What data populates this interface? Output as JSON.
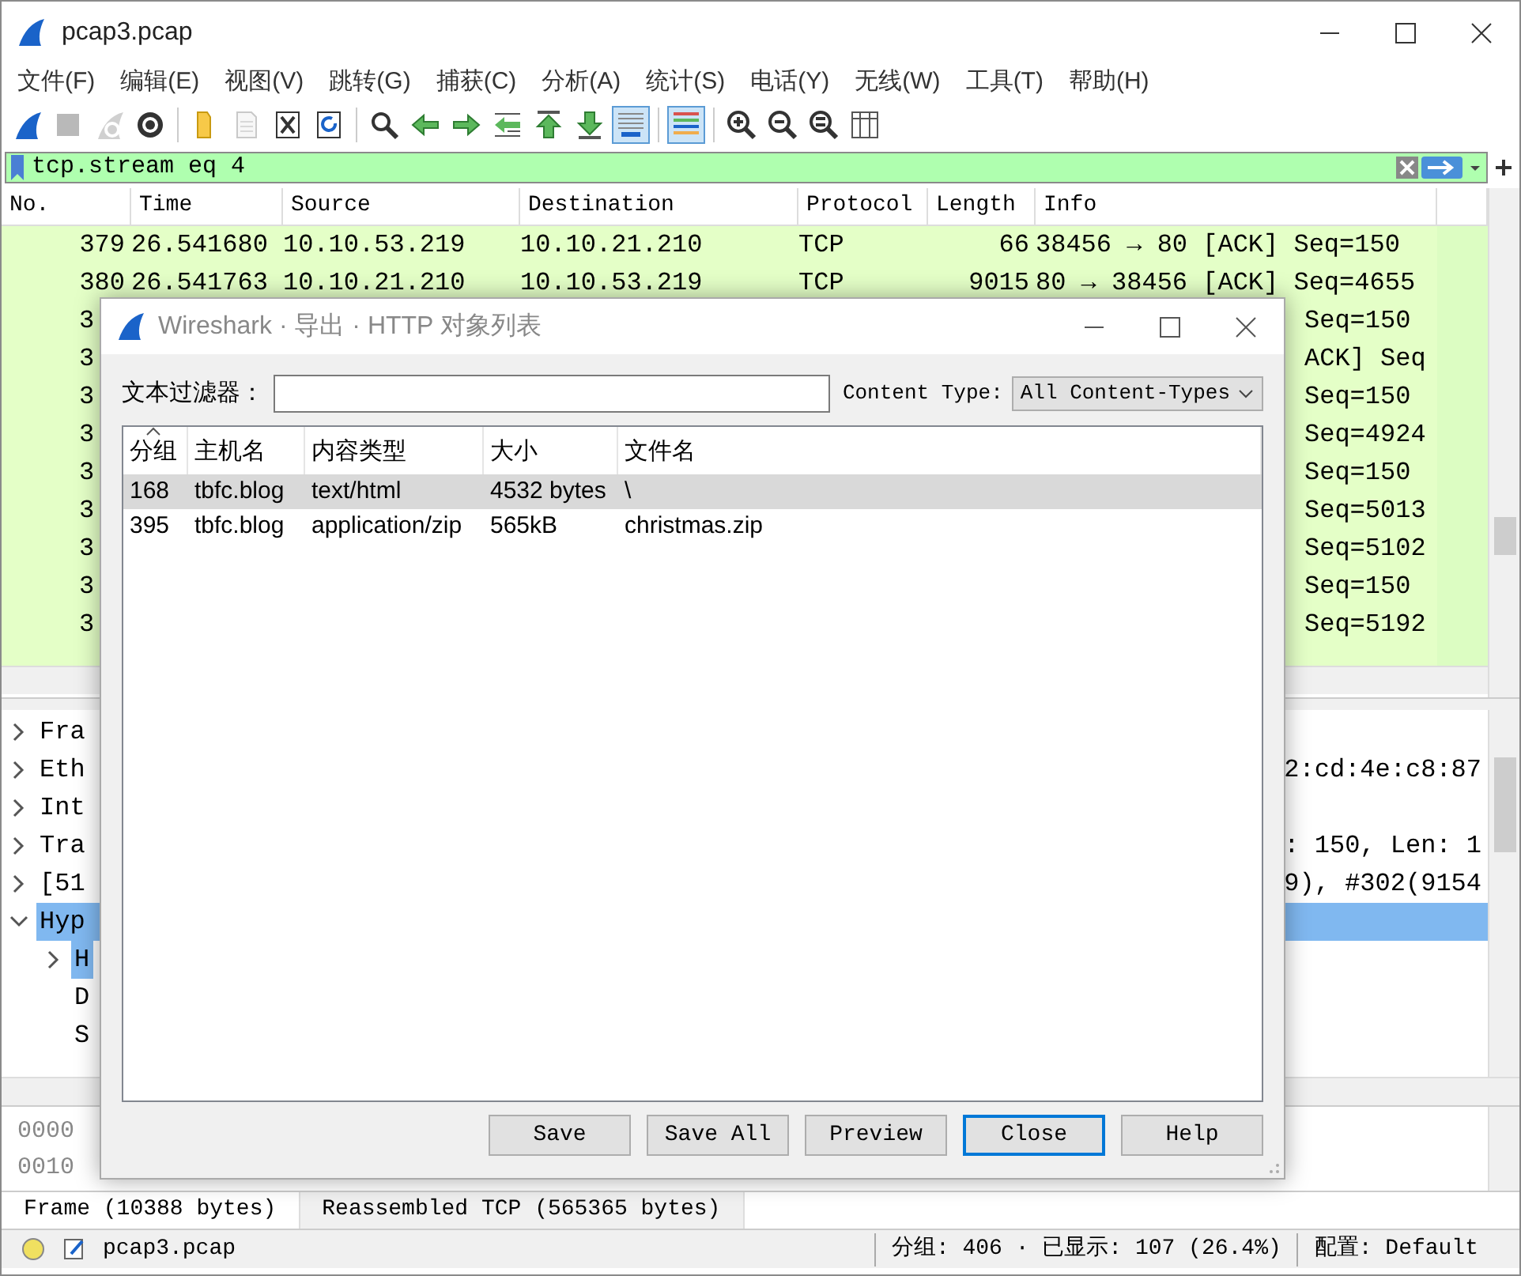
{
  "window": {
    "title": "pcap3.pcap"
  },
  "menu": [
    "文件(F)",
    "编辑(E)",
    "视图(V)",
    "跳转(G)",
    "捕获(C)",
    "分析(A)",
    "统计(S)",
    "电话(Y)",
    "无线(W)",
    "工具(T)",
    "帮助(H)"
  ],
  "toolbar": [
    [
      {
        "kind": "shark",
        "disabled": false,
        "pressed": false
      },
      {
        "kind": "stop",
        "disabled": true,
        "pressed": false
      },
      {
        "kind": "restart",
        "disabled": true,
        "pressed": false
      },
      {
        "kind": "options",
        "disabled": false,
        "pressed": false
      }
    ],
    [
      {
        "kind": "open",
        "disabled": false,
        "pressed": false
      },
      {
        "kind": "file",
        "disabled": true,
        "pressed": false
      },
      {
        "kind": "close",
        "disabled": false,
        "pressed": false
      },
      {
        "kind": "reload",
        "disabled": false,
        "pressed": false
      }
    ],
    [
      {
        "kind": "find",
        "disabled": false,
        "pressed": false
      },
      {
        "kind": "back",
        "disabled": false,
        "pressed": false
      },
      {
        "kind": "forward",
        "disabled": false,
        "pressed": false
      },
      {
        "kind": "goto",
        "disabled": false,
        "pressed": false
      },
      {
        "kind": "first",
        "disabled": false,
        "pressed": false
      },
      {
        "kind": "last",
        "disabled": false,
        "pressed": false
      },
      {
        "kind": "autoscroll",
        "disabled": false,
        "pressed": true
      }
    ],
    [
      {
        "kind": "colorize",
        "disabled": false,
        "pressed": true
      }
    ],
    [
      {
        "kind": "zoom_in",
        "disabled": false,
        "pressed": false
      },
      {
        "kind": "zoom_out",
        "disabled": false,
        "pressed": false
      },
      {
        "kind": "zoom_reset",
        "disabled": false,
        "pressed": false
      },
      {
        "kind": "resize",
        "disabled": false,
        "pressed": false
      }
    ]
  ],
  "display_filter": {
    "value": "tcp.stream eq 4"
  },
  "packet_list": {
    "columns": [
      "No.",
      "Time",
      "Source",
      "Destination",
      "Protocol",
      "Length",
      "Info"
    ],
    "rows": [
      {
        "kind": "full",
        "no": "379",
        "time": "26.541680",
        "source": "10.10.53.219",
        "destination": "10.10.21.210",
        "protocol": "TCP",
        "length": "66",
        "info": "38456 → 80 [ACK] Seq=150"
      },
      {
        "kind": "full",
        "no": "380",
        "time": "26.541763",
        "source": "10.10.21.210",
        "destination": "10.10.53.219",
        "protocol": "TCP",
        "length": "9015",
        "info": "80 → 38456 [ACK] Seq=4655"
      },
      {
        "kind": "partial",
        "no": "3",
        "info": "Seq=150"
      },
      {
        "kind": "partial",
        "no": "3",
        "info": "ACK] Seq"
      },
      {
        "kind": "partial",
        "no": "3",
        "info": "Seq=150"
      },
      {
        "kind": "partial",
        "no": "3",
        "info": "Seq=4924"
      },
      {
        "kind": "partial",
        "no": "3",
        "info": "Seq=150"
      },
      {
        "kind": "partial",
        "no": "3",
        "info": "Seq=5013"
      },
      {
        "kind": "partial",
        "no": "3",
        "info": "Seq=5102"
      },
      {
        "kind": "partial",
        "no": "3",
        "info": "Seq=150"
      },
      {
        "kind": "partial",
        "no": "3",
        "info": "Seq=5192"
      }
    ]
  },
  "details": [
    {
      "label": "Fra",
      "expanded": false,
      "selected": false
    },
    {
      "label": "Eth",
      "detail": "2:cd:4e:c8:87",
      "expanded": false,
      "selected": false
    },
    {
      "label": "Int",
      "expanded": false,
      "selected": false
    },
    {
      "label": "Tra",
      "detail": ": 150, Len: 1",
      "expanded": false,
      "selected": false
    },
    {
      "label": "[51",
      "detail": "9), #302(9154",
      "expanded": false,
      "selected": false
    },
    {
      "label": "Hyp",
      "expanded": true,
      "selected": true,
      "children": [
        {
          "label": "H",
          "expanded": false,
          "selected": true,
          "expandable": true
        },
        {
          "label": "D",
          "selected": false,
          "expandable": false
        },
        {
          "label": "S",
          "selected": false,
          "expandable": false
        }
      ]
    }
  ],
  "hex_offsets": [
    "0000",
    "0010"
  ],
  "byte_tabs": [
    {
      "label": "Frame (10388 bytes)",
      "selected": true
    },
    {
      "label": "Reassembled TCP (565365 bytes)",
      "selected": false
    }
  ],
  "status_bar": {
    "file": "pcap3.pcap",
    "packets": "分组: 406 · 已显示: 107 (26.4%)",
    "profile": "配置: Default"
  },
  "dialog": {
    "title": "Wireshark · 导出 · HTTP 对象列表",
    "filter_label": "文本过滤器：",
    "content_type_label": "Content Type:",
    "content_type_value": "All Content-Types",
    "columns": [
      {
        "label": "分组",
        "sorted": true
      },
      {
        "label": "主机名",
        "sorted": false
      },
      {
        "label": "内容类型",
        "sorted": false
      },
      {
        "label": "大小",
        "sorted": false
      },
      {
        "label": "文件名",
        "sorted": false
      }
    ],
    "rows": [
      {
        "cells": [
          "168",
          "tbfc.blog",
          "text/html",
          "4532 bytes",
          "\\"
        ],
        "selected": true
      },
      {
        "cells": [
          "395",
          "tbfc.blog",
          "application/zip",
          "565kB",
          "christmas.zip"
        ],
        "selected": false
      }
    ],
    "buttons": [
      {
        "label": "Save",
        "default": false
      },
      {
        "label": "Save All",
        "default": false
      },
      {
        "label": "Preview",
        "default": false
      },
      {
        "label": "Close",
        "default": true
      },
      {
        "label": "Help",
        "default": false
      }
    ]
  }
}
